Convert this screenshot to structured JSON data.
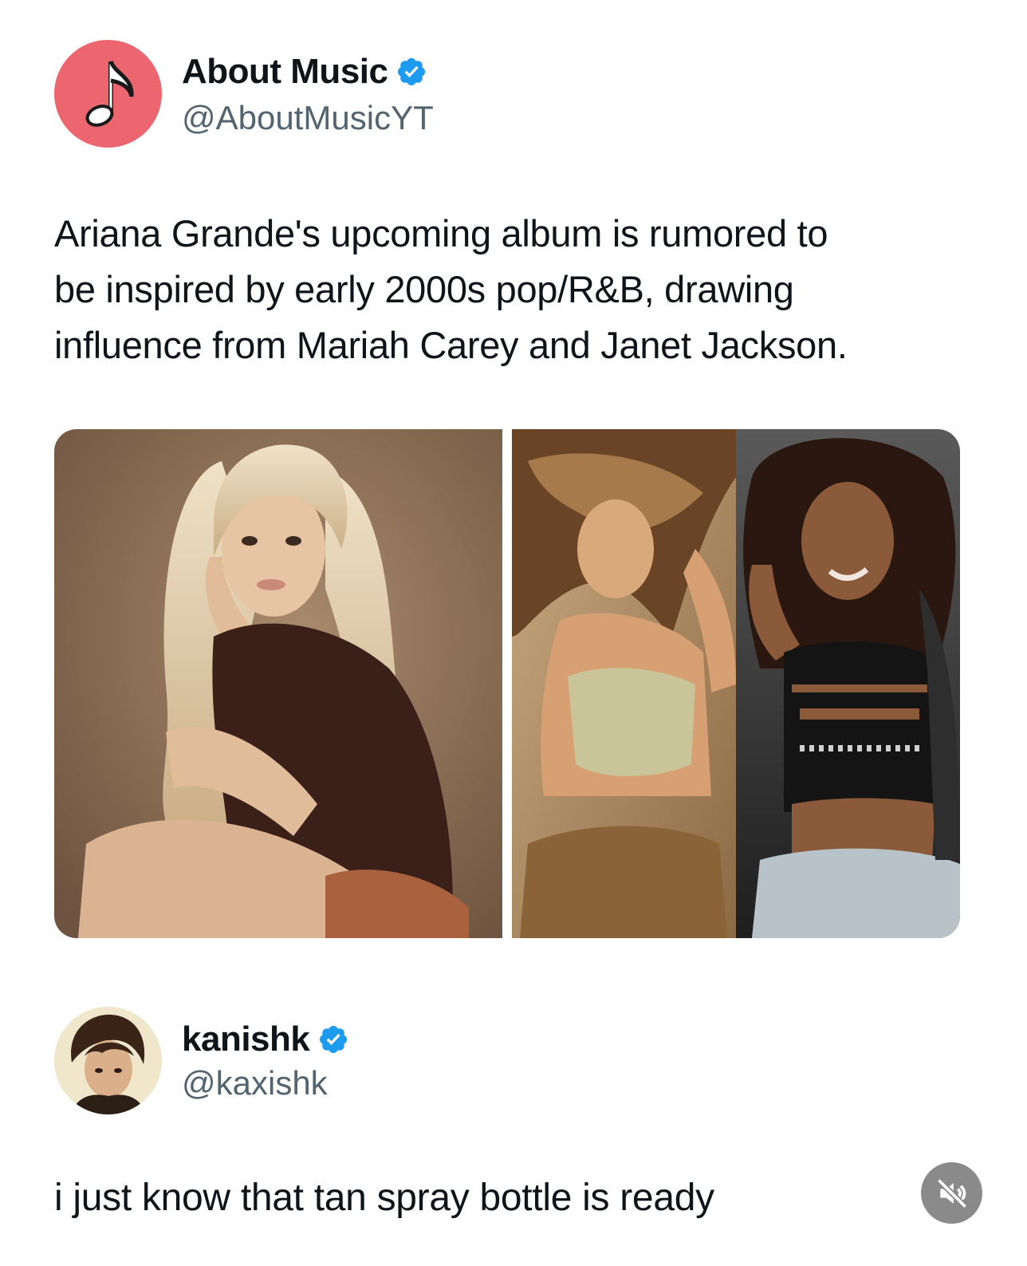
{
  "tweet": {
    "author": {
      "display_name": "About Music",
      "handle": "@AboutMusicYT",
      "verified": true,
      "avatar_icon": "music-note-icon",
      "avatar_color": "#ec6670"
    },
    "text_lines": [
      "Ariana Grande's upcoming album is rumored to",
      "be inspired by early 2000s pop/R&B, drawing",
      "influence from Mariah Carey and Janet Jackson."
    ],
    "media": [
      {
        "icon": "photo-ariana"
      },
      {
        "icon": "photo-mariah"
      },
      {
        "icon": "photo-janet"
      }
    ]
  },
  "reply": {
    "author": {
      "display_name": "kanishk",
      "handle": "@kaxishk",
      "verified": true,
      "avatar_icon": "profile-photo-icon"
    },
    "text": "i just know that tan spray bottle is ready"
  },
  "controls": {
    "mute_icon": "speaker-muted-icon"
  },
  "colors": {
    "verified_blue": "#1d9bf0",
    "handle_gray": "#536471",
    "text": "#0f1419"
  }
}
